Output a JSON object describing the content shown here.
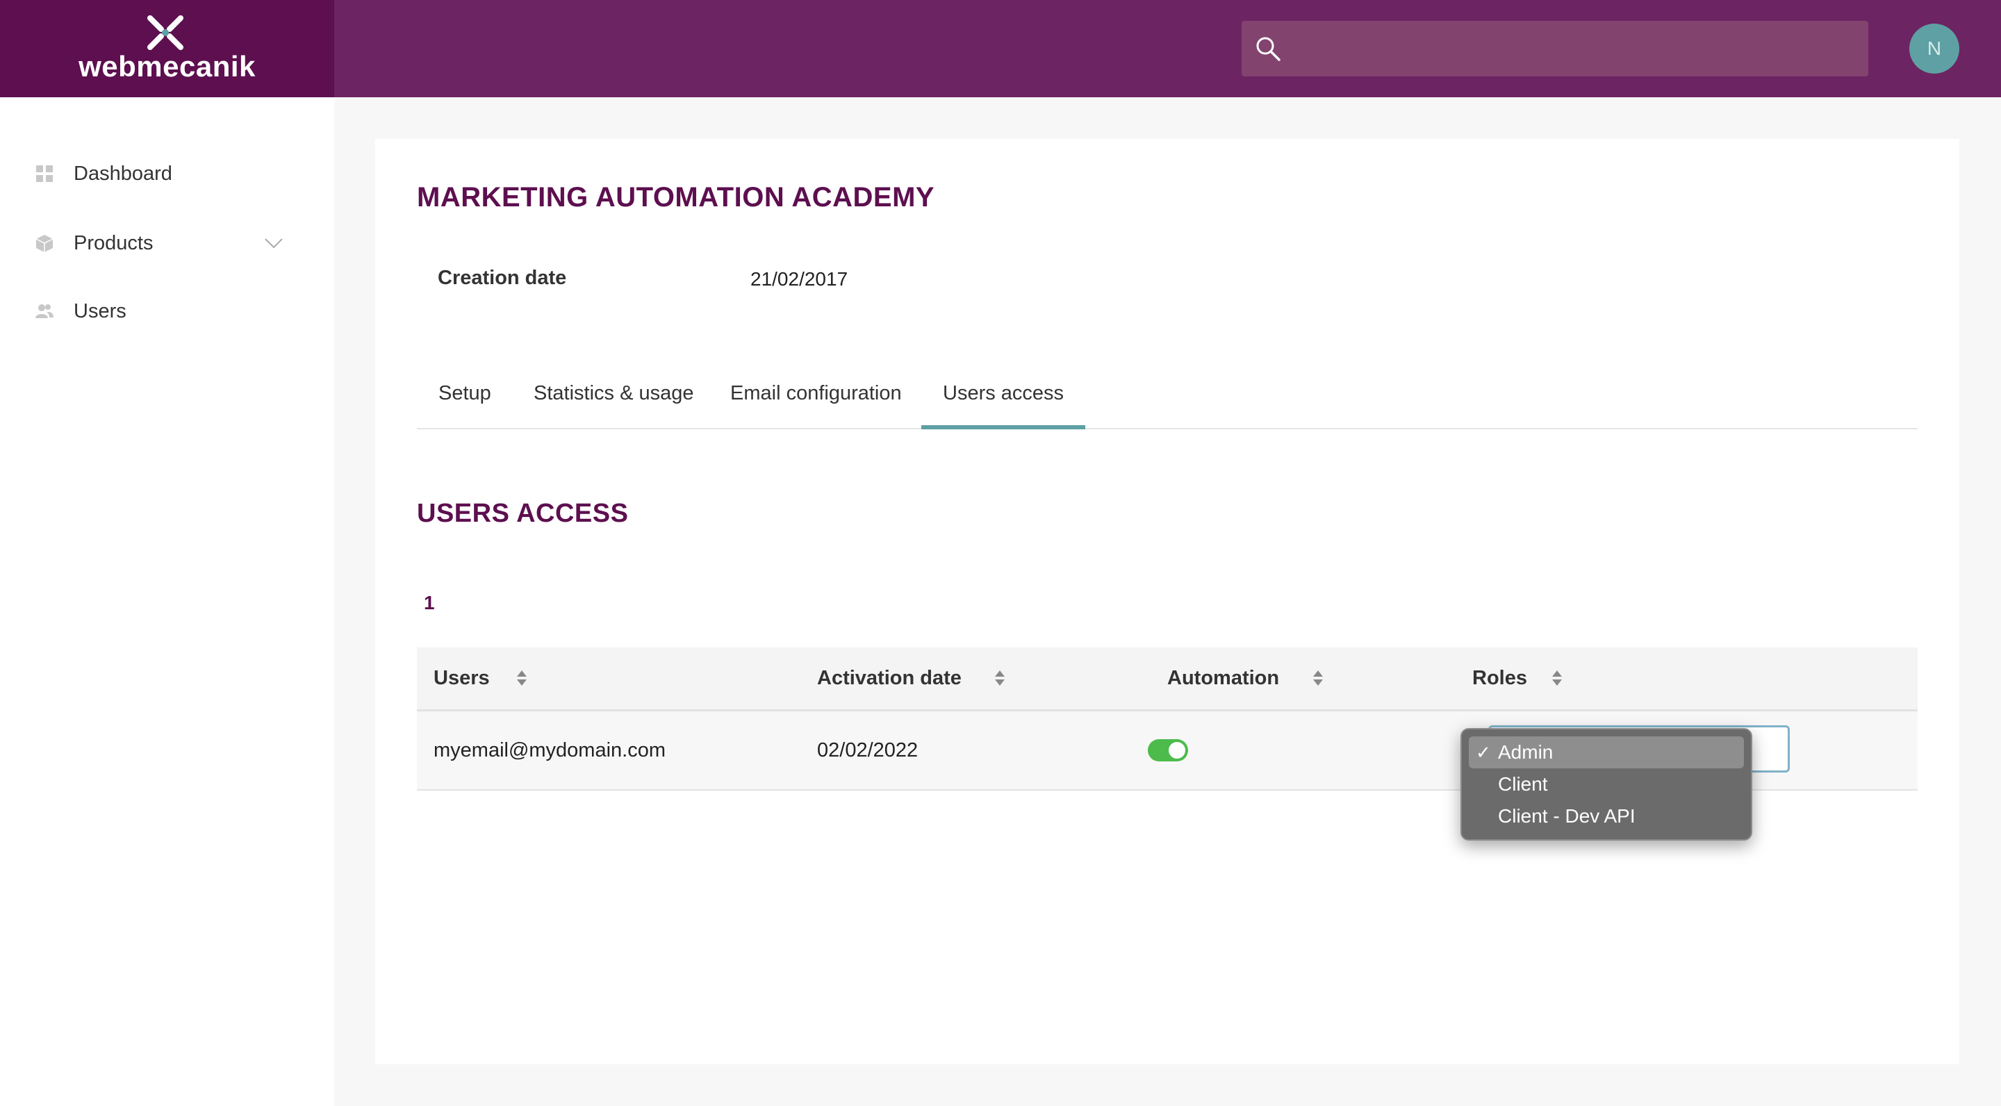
{
  "header": {
    "logo_text": "webmecanik",
    "search_placeholder": "",
    "avatar_initial": "N"
  },
  "sidebar": {
    "items": [
      {
        "label": "Dashboard",
        "icon": "grid-icon"
      },
      {
        "label": "Products",
        "icon": "box-icon",
        "expandable": true
      },
      {
        "label": "Users",
        "icon": "users-icon"
      }
    ]
  },
  "main": {
    "title": "MARKETING AUTOMATION ACADEMY",
    "creation_label": "Creation date",
    "creation_value": "21/02/2017",
    "tabs": [
      {
        "label": "Setup",
        "active": false
      },
      {
        "label": "Statistics & usage",
        "active": false
      },
      {
        "label": "Email configuration",
        "active": false
      },
      {
        "label": "Users access",
        "active": true
      }
    ],
    "section_title": "USERS ACCESS",
    "page_number": "1",
    "table": {
      "headers": [
        "Users",
        "Activation date",
        "Automation",
        "Roles"
      ],
      "rows": [
        {
          "user": "myemail@mydomain.com",
          "activation_date": "02/02/2022",
          "automation": true,
          "role": "Admin"
        }
      ]
    },
    "role_dropdown": {
      "check": "✓",
      "options": [
        "Admin",
        "Client",
        "Client - Dev API"
      ],
      "selected": "Admin"
    }
  },
  "colors": {
    "header": "#6c2462",
    "logo_bg": "#5d0f4f",
    "accent": "#5ea0a3",
    "title": "#5d0f4f",
    "toggle_on": "#4cbb4c"
  }
}
